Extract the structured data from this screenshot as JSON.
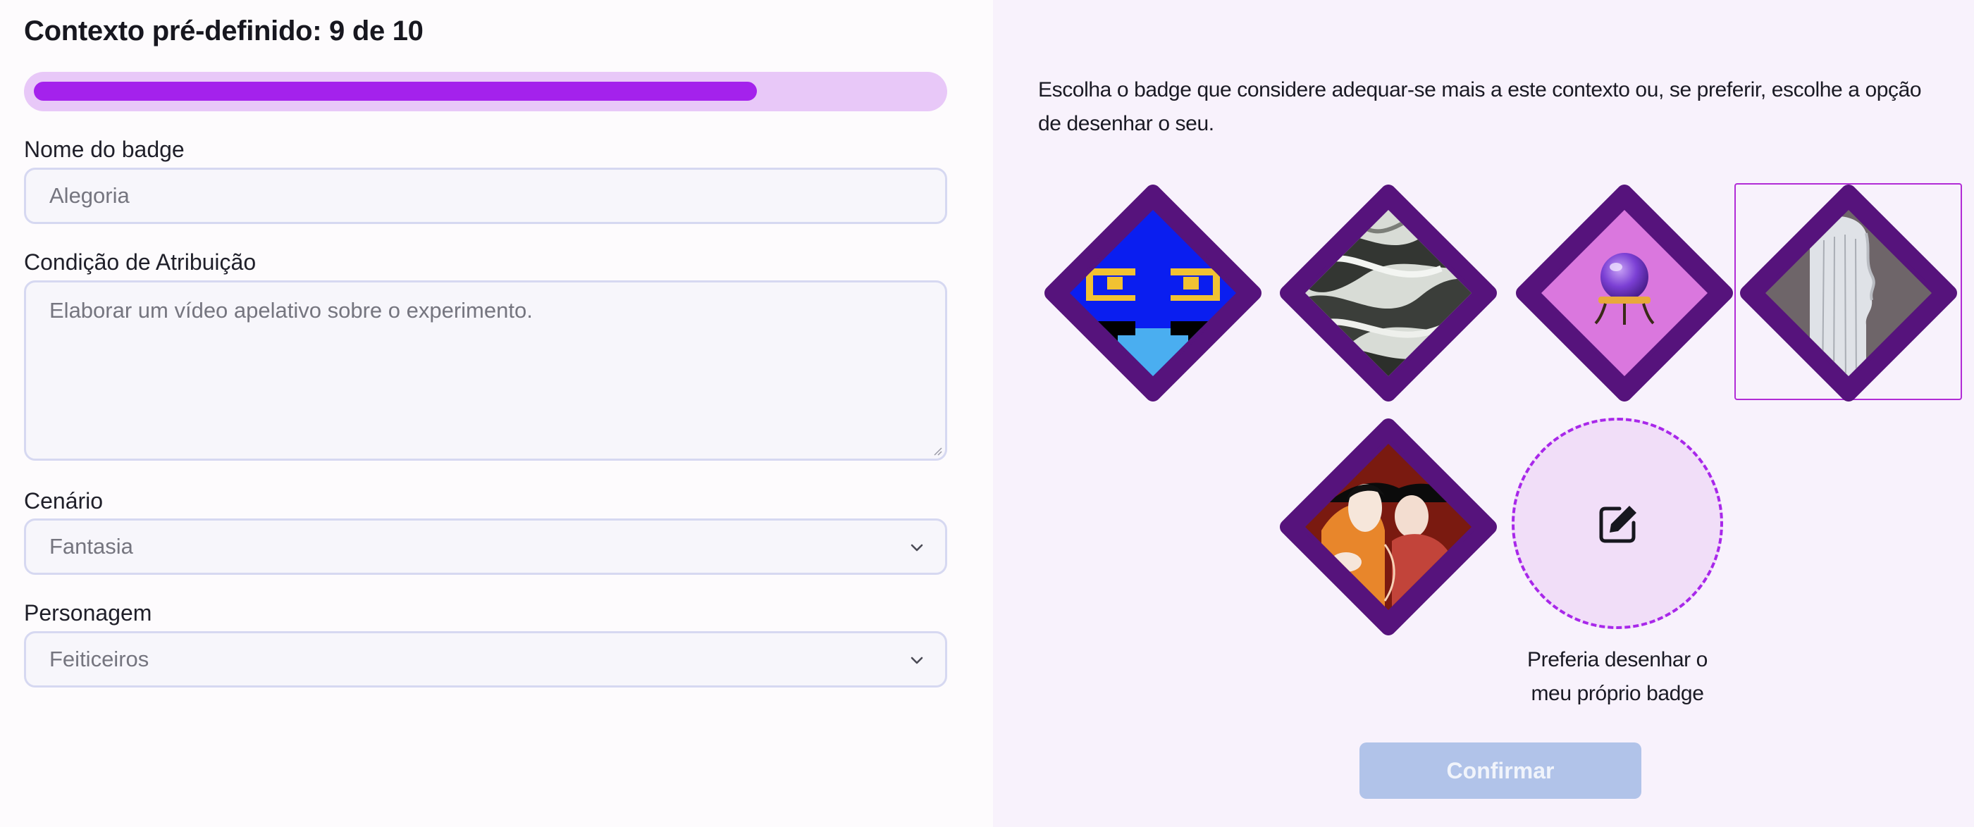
{
  "header": {
    "title": "Contexto pré-definido: 9 de 10"
  },
  "progress": {
    "current": 9,
    "total": 10,
    "fraction": 0.8
  },
  "form": {
    "badge_name": {
      "label": "Nome do badge",
      "value": "Alegoria"
    },
    "condition": {
      "label": "Condição de Atribuição",
      "value": "Elaborar um vídeo apelativo sobre o experimento."
    },
    "scenario": {
      "label": "Cenário",
      "value": "Fantasia"
    },
    "character": {
      "label": "Personagem",
      "value": "Feiticeiros"
    }
  },
  "selection": {
    "instructions": "Escolha o badge que considere adequar-se mais a este contexto ou, se preferir, escolhe a opção de desenhar o seu.",
    "badges": [
      {
        "name": "pixel-eyes-badge",
        "selected": false
      },
      {
        "name": "marble-swirl-badge",
        "selected": false
      },
      {
        "name": "crystal-ball-badge",
        "selected": false
      },
      {
        "name": "veiled-profile-badge",
        "selected": true
      },
      {
        "name": "couple-illustration-badge",
        "selected": false
      }
    ],
    "draw_own_label": "Preferia desenhar o meu próprio badge",
    "draw_icon": "edit-icon",
    "confirm_label": "Confirmar"
  },
  "colors": {
    "accent": "#a422ec",
    "badge_frame": "#56137c",
    "progress_track": "#e8c8f8",
    "confirm_disabled": "#b1c3e9"
  }
}
